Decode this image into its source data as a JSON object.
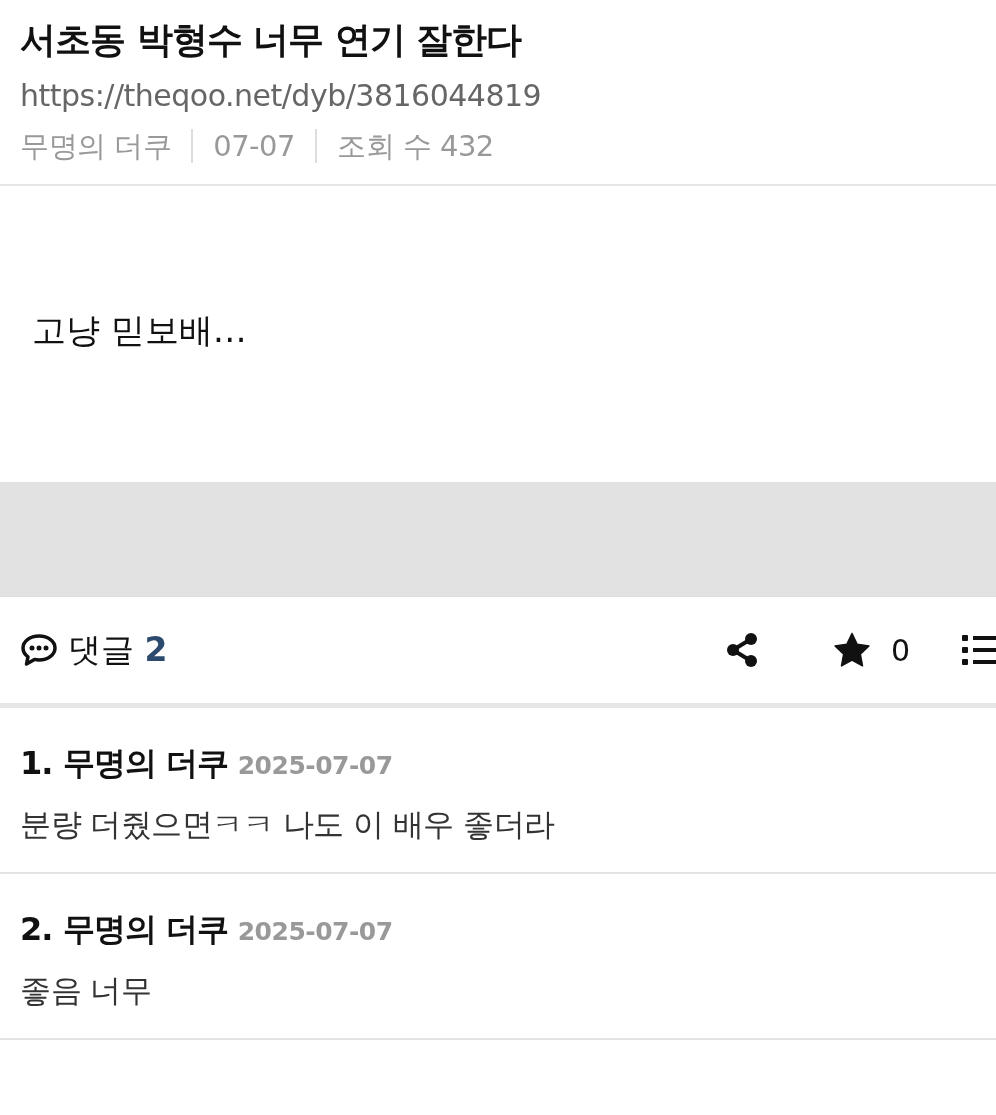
{
  "post": {
    "title": "서초동 박형수 너무 연기 잘한다",
    "url": "https://theqoo.net/dyb/3816044819",
    "meta": [
      "무명의 더쿠",
      "07-07",
      "조회 수 432"
    ],
    "body": "고냥 믿보배…"
  },
  "toolbar": {
    "comment_label": "댓글",
    "comment_count": "2",
    "star_count": "0"
  },
  "comments": [
    {
      "number": "1.",
      "author": "무명의 더쿠",
      "date": "2025-07-07",
      "text": "분량 더줬으면ㅋㅋ 나도 이 배우 좋더라"
    },
    {
      "number": "2.",
      "author": "무명의 더쿠",
      "date": "2025-07-07",
      "text": "좋음 너무"
    }
  ]
}
